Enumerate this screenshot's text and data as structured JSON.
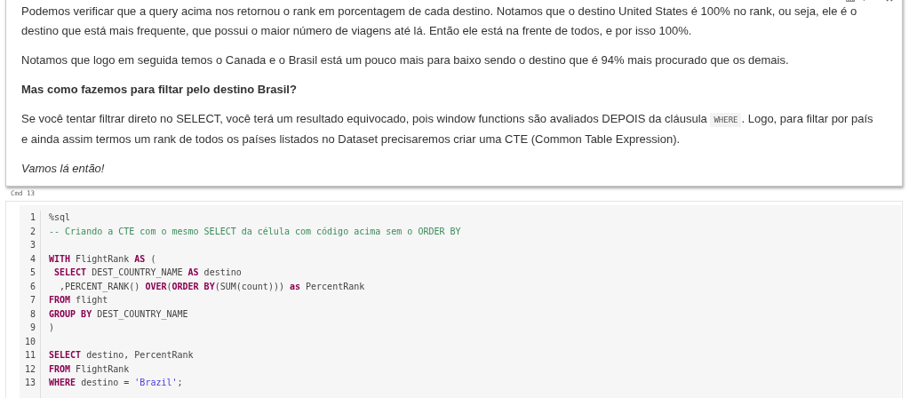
{
  "markdown_cell": {
    "paragraphs": [
      {
        "kind": "plain",
        "parts": [
          {
            "kind": "text",
            "text": "Podemos verificar que a query acima nos retornou o rank em porcentagem de cada destino. Notamos que o destino United States é 100% no rank, ou seja, ele é o destino que está mais frequente, que possui o maior número de viagens até lá. Então ele está na frente de todos, e por isso 100%."
          }
        ]
      },
      {
        "kind": "plain",
        "parts": [
          {
            "kind": "text",
            "text": "Notamos que logo em seguida temos o Canada e o Brasil está um pouco mais para baixo sendo o destino que é 94% mais procurado que os demais."
          }
        ]
      },
      {
        "kind": "bold",
        "parts": [
          {
            "kind": "text",
            "text": "Mas como fazemos para filtar pelo destino Brasil?"
          }
        ]
      },
      {
        "kind": "plain",
        "parts": [
          {
            "kind": "text",
            "text": "Se você tentar filtrar direto no SELECT, você terá um resultado equivocado, pois window functions são avaliados DEPOIS da cláusula "
          },
          {
            "kind": "code",
            "text": "WHERE"
          },
          {
            "kind": "text",
            "text": ". Logo, para filtar por país e ainda assim termos um rank de todos os países listados no Dataset precisaremos criar uma CTE (Common Table Expression)."
          }
        ]
      },
      {
        "kind": "italic",
        "parts": [
          {
            "kind": "text",
            "text": "Vamos lá então!"
          }
        ]
      }
    ]
  },
  "code_cell": {
    "label": "Cmd 13",
    "lines": [
      {
        "number": "1",
        "tokens": [
          {
            "kind": "plain",
            "text": "%sql"
          }
        ]
      },
      {
        "number": "2",
        "tokens": [
          {
            "kind": "comment",
            "text": "-- Criando a CTE com o mesmo SELECT da célula com código acima sem o ORDER BY"
          }
        ]
      },
      {
        "number": "3"
      },
      {
        "number": "4",
        "tokens": [
          {
            "kind": "keyword",
            "text": "WITH"
          },
          {
            "kind": "plain",
            "text": " FlightRank "
          },
          {
            "kind": "keyword",
            "text": "AS"
          },
          {
            "kind": "plain",
            "text": " ("
          }
        ]
      },
      {
        "number": "5",
        "tokens": [
          {
            "kind": "keyword",
            "text": " SELECT"
          },
          {
            "kind": "plain",
            "text": " DEST_COUNTRY_NAME "
          },
          {
            "kind": "keyword",
            "text": "AS"
          },
          {
            "kind": "plain",
            "text": " destino"
          }
        ]
      },
      {
        "number": "6",
        "tokens": [
          {
            "kind": "plain",
            "text": "  ,PERCENT_RANK() "
          },
          {
            "kind": "keyword",
            "text": "OVER"
          },
          {
            "kind": "plain",
            "text": "("
          },
          {
            "kind": "keyword",
            "text": "ORDER BY"
          },
          {
            "kind": "plain",
            "text": "(SUM(count))) "
          },
          {
            "kind": "keyword",
            "text": "as"
          },
          {
            "kind": "plain",
            "text": " PercentRank"
          }
        ]
      },
      {
        "number": "7",
        "tokens": [
          {
            "kind": "keyword",
            "text": "FROM"
          },
          {
            "kind": "plain",
            "text": " flight"
          }
        ]
      },
      {
        "number": "8",
        "tokens": [
          {
            "kind": "keyword",
            "text": "GROUP BY"
          },
          {
            "kind": "plain",
            "text": " DEST_COUNTRY_NAME"
          }
        ]
      },
      {
        "number": "9",
        "tokens": [
          {
            "kind": "plain",
            "text": ")"
          }
        ]
      },
      {
        "number": "10"
      },
      {
        "number": "11",
        "tokens": [
          {
            "kind": "keyword",
            "text": "SELECT"
          },
          {
            "kind": "plain",
            "text": " destino, PercentRank"
          }
        ]
      },
      {
        "number": "12",
        "tokens": [
          {
            "kind": "keyword",
            "text": "FROM"
          },
          {
            "kind": "plain",
            "text": " FlightRank"
          }
        ]
      },
      {
        "number": "13",
        "tokens": [
          {
            "kind": "keyword",
            "text": "WHERE"
          },
          {
            "kind": "plain",
            "text": " destino = "
          },
          {
            "kind": "string",
            "text": "'Brazil'"
          },
          {
            "kind": "plain",
            "text": ";"
          }
        ]
      }
    ]
  }
}
